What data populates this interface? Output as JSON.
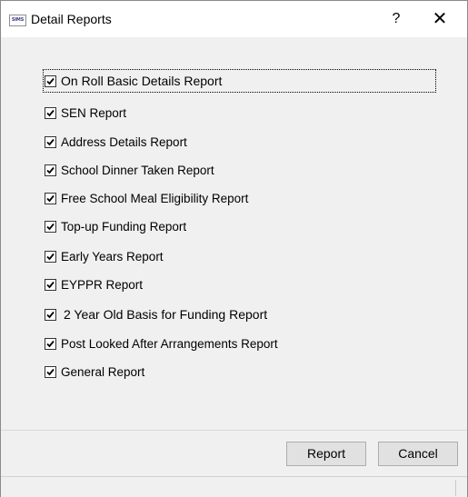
{
  "window": {
    "title": "Detail Reports",
    "app_icon_text": "SIMS",
    "help_symbol": "?",
    "close_symbol": "✕"
  },
  "reports": [
    {
      "label": "On Roll Basic Details Report",
      "checked": true
    },
    {
      "label": "SEN Report",
      "checked": true
    },
    {
      "label": "Address Details Report",
      "checked": true
    },
    {
      "label": "School Dinner Taken Report",
      "checked": true
    },
    {
      "label": "Free School Meal Eligibility Report",
      "checked": true
    },
    {
      "label": "Top-up Funding Report",
      "checked": true
    },
    {
      "label": "Early Years Report",
      "checked": true
    },
    {
      "label": "EYPPR Report",
      "checked": true
    },
    {
      "label": "2 Year Old Basis for Funding Report",
      "checked": true
    },
    {
      "label": "Post Looked After Arrangements Report",
      "checked": true
    },
    {
      "label": "General Report",
      "checked": true
    }
  ],
  "buttons": {
    "report_label": "Report",
    "cancel_label": "Cancel"
  }
}
